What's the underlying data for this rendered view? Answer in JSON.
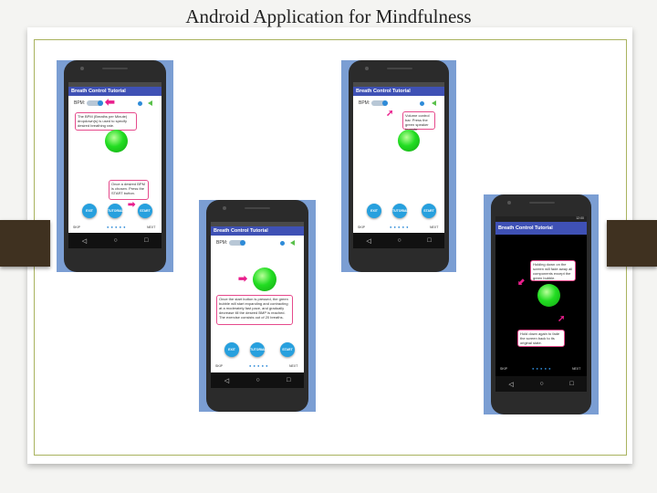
{
  "slide": {
    "title": "Android Application for Mindfulness"
  },
  "app_title": "Breath Control Tutorial",
  "bpm_label": "BPM:",
  "buttons": {
    "exit": "EXIT",
    "tutorial": "TUTORIAL",
    "start": "START"
  },
  "skip": "SKIP",
  "next": "NEXT",
  "page_dots": "● ● ● ● ●",
  "nav": {
    "back": "◁",
    "home": "○",
    "recent": "□"
  },
  "notes": {
    "bpm_hint": "The BPM (Breaths per Minute) dropdown(s) is used to specify desired breathing rate.",
    "start_hint": "Once a desired BPM is chosen. Press the START button.",
    "volume_hint": "Volume control bar. Press the green speaker to mute.",
    "bubble_hint": "Once the start button is pressed, the green bubble will start expanding and contracting at a moderately fast pace, and gradually decrease till the desired BMP is reached. The exercise consists out of 20 breaths.",
    "hold_hint": "Holding down on the screen will fade away all components except the green bubble.",
    "release_hint": "Hold down again to fade the screen back to its original state."
  },
  "status_time": "12:00",
  "colors": {
    "accent": "#3f51b5",
    "bubble": "#22dd22",
    "button": "#27a0de",
    "callout": "#e91e8c",
    "frame_bg": "#7b9ed3"
  }
}
